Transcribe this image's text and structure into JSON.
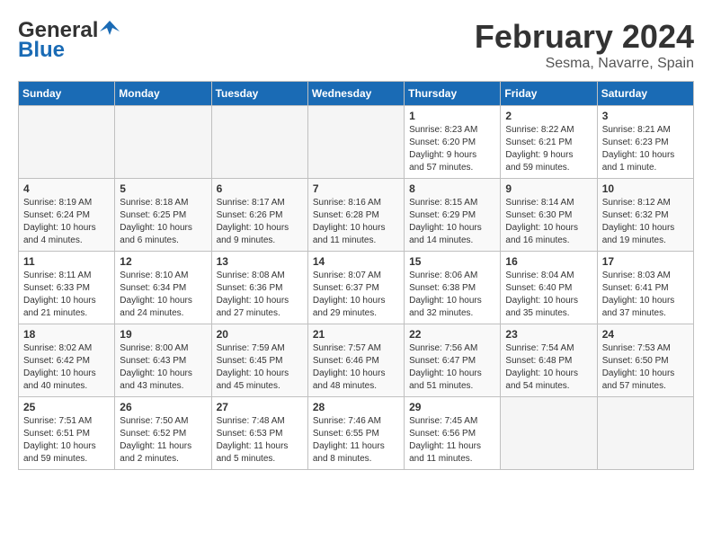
{
  "header": {
    "logo_general": "General",
    "logo_blue": "Blue",
    "title": "February 2024",
    "location": "Sesma, Navarre, Spain"
  },
  "weekdays": [
    "Sunday",
    "Monday",
    "Tuesday",
    "Wednesday",
    "Thursday",
    "Friday",
    "Saturday"
  ],
  "weeks": [
    [
      {
        "day": "",
        "info": ""
      },
      {
        "day": "",
        "info": ""
      },
      {
        "day": "",
        "info": ""
      },
      {
        "day": "",
        "info": ""
      },
      {
        "day": "1",
        "info": "Sunrise: 8:23 AM\nSunset: 6:20 PM\nDaylight: 9 hours\nand 57 minutes."
      },
      {
        "day": "2",
        "info": "Sunrise: 8:22 AM\nSunset: 6:21 PM\nDaylight: 9 hours\nand 59 minutes."
      },
      {
        "day": "3",
        "info": "Sunrise: 8:21 AM\nSunset: 6:23 PM\nDaylight: 10 hours\nand 1 minute."
      }
    ],
    [
      {
        "day": "4",
        "info": "Sunrise: 8:19 AM\nSunset: 6:24 PM\nDaylight: 10 hours\nand 4 minutes."
      },
      {
        "day": "5",
        "info": "Sunrise: 8:18 AM\nSunset: 6:25 PM\nDaylight: 10 hours\nand 6 minutes."
      },
      {
        "day": "6",
        "info": "Sunrise: 8:17 AM\nSunset: 6:26 PM\nDaylight: 10 hours\nand 9 minutes."
      },
      {
        "day": "7",
        "info": "Sunrise: 8:16 AM\nSunset: 6:28 PM\nDaylight: 10 hours\nand 11 minutes."
      },
      {
        "day": "8",
        "info": "Sunrise: 8:15 AM\nSunset: 6:29 PM\nDaylight: 10 hours\nand 14 minutes."
      },
      {
        "day": "9",
        "info": "Sunrise: 8:14 AM\nSunset: 6:30 PM\nDaylight: 10 hours\nand 16 minutes."
      },
      {
        "day": "10",
        "info": "Sunrise: 8:12 AM\nSunset: 6:32 PM\nDaylight: 10 hours\nand 19 minutes."
      }
    ],
    [
      {
        "day": "11",
        "info": "Sunrise: 8:11 AM\nSunset: 6:33 PM\nDaylight: 10 hours\nand 21 minutes."
      },
      {
        "day": "12",
        "info": "Sunrise: 8:10 AM\nSunset: 6:34 PM\nDaylight: 10 hours\nand 24 minutes."
      },
      {
        "day": "13",
        "info": "Sunrise: 8:08 AM\nSunset: 6:36 PM\nDaylight: 10 hours\nand 27 minutes."
      },
      {
        "day": "14",
        "info": "Sunrise: 8:07 AM\nSunset: 6:37 PM\nDaylight: 10 hours\nand 29 minutes."
      },
      {
        "day": "15",
        "info": "Sunrise: 8:06 AM\nSunset: 6:38 PM\nDaylight: 10 hours\nand 32 minutes."
      },
      {
        "day": "16",
        "info": "Sunrise: 8:04 AM\nSunset: 6:40 PM\nDaylight: 10 hours\nand 35 minutes."
      },
      {
        "day": "17",
        "info": "Sunrise: 8:03 AM\nSunset: 6:41 PM\nDaylight: 10 hours\nand 37 minutes."
      }
    ],
    [
      {
        "day": "18",
        "info": "Sunrise: 8:02 AM\nSunset: 6:42 PM\nDaylight: 10 hours\nand 40 minutes."
      },
      {
        "day": "19",
        "info": "Sunrise: 8:00 AM\nSunset: 6:43 PM\nDaylight: 10 hours\nand 43 minutes."
      },
      {
        "day": "20",
        "info": "Sunrise: 7:59 AM\nSunset: 6:45 PM\nDaylight: 10 hours\nand 45 minutes."
      },
      {
        "day": "21",
        "info": "Sunrise: 7:57 AM\nSunset: 6:46 PM\nDaylight: 10 hours\nand 48 minutes."
      },
      {
        "day": "22",
        "info": "Sunrise: 7:56 AM\nSunset: 6:47 PM\nDaylight: 10 hours\nand 51 minutes."
      },
      {
        "day": "23",
        "info": "Sunrise: 7:54 AM\nSunset: 6:48 PM\nDaylight: 10 hours\nand 54 minutes."
      },
      {
        "day": "24",
        "info": "Sunrise: 7:53 AM\nSunset: 6:50 PM\nDaylight: 10 hours\nand 57 minutes."
      }
    ],
    [
      {
        "day": "25",
        "info": "Sunrise: 7:51 AM\nSunset: 6:51 PM\nDaylight: 10 hours\nand 59 minutes."
      },
      {
        "day": "26",
        "info": "Sunrise: 7:50 AM\nSunset: 6:52 PM\nDaylight: 11 hours\nand 2 minutes."
      },
      {
        "day": "27",
        "info": "Sunrise: 7:48 AM\nSunset: 6:53 PM\nDaylight: 11 hours\nand 5 minutes."
      },
      {
        "day": "28",
        "info": "Sunrise: 7:46 AM\nSunset: 6:55 PM\nDaylight: 11 hours\nand 8 minutes."
      },
      {
        "day": "29",
        "info": "Sunrise: 7:45 AM\nSunset: 6:56 PM\nDaylight: 11 hours\nand 11 minutes."
      },
      {
        "day": "",
        "info": ""
      },
      {
        "day": "",
        "info": ""
      }
    ]
  ]
}
